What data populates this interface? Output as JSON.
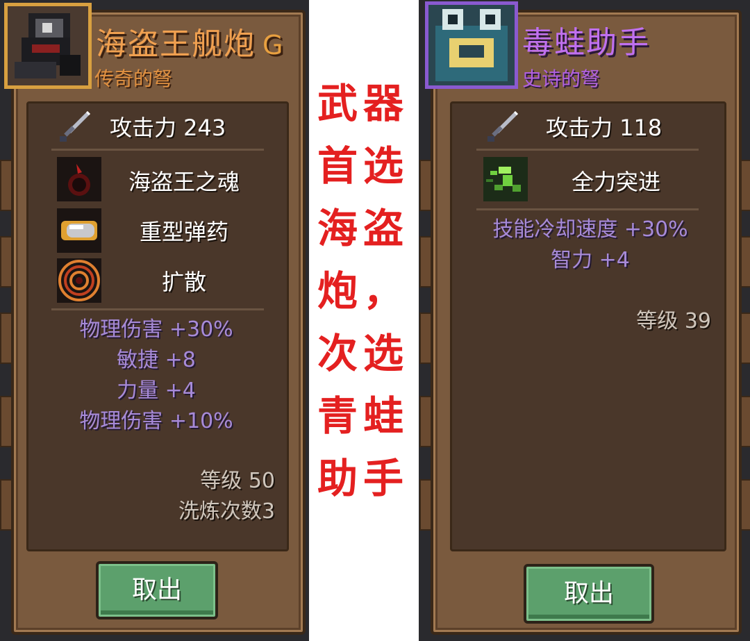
{
  "left_item": {
    "name": "海盗王舰炮",
    "grade": "G",
    "rarity": "传奇的弩",
    "attack_label": "攻击力 243",
    "skills": [
      {
        "label": "海盗王之魂",
        "icon": "fire-orb-icon"
      },
      {
        "label": "重型弹药",
        "icon": "heavy-bullet-icon"
      },
      {
        "label": "扩散",
        "icon": "spread-rings-icon"
      }
    ],
    "stats": [
      "物理伤害 +30%",
      "敏捷 +8",
      "力量 +4",
      "物理伤害 +10%"
    ],
    "level": "等级 50",
    "reforge": "洗炼次数3",
    "button": "取出"
  },
  "right_item": {
    "name": "毒蛙助手",
    "rarity": "史诗的弩",
    "attack_label": "攻击力 118",
    "skills": [
      {
        "label": "全力突进",
        "icon": "dash-icon"
      }
    ],
    "stats": [
      "技能冷却速度 +30%",
      "智力 +4"
    ],
    "level": "等级 39",
    "button": "取出"
  },
  "overlay": {
    "col1": [
      "武",
      "首",
      "海",
      "炮",
      "次",
      "青",
      "助"
    ],
    "col2": [
      "器",
      "选",
      "盗",
      "，",
      "选",
      "蛙",
      "手"
    ]
  },
  "colors": {
    "legendary": "#f0a050",
    "epic": "#c070f0",
    "stat_purple": "#a78ad8",
    "annotation_red": "#e42020",
    "button_green": "#5ca06c"
  }
}
